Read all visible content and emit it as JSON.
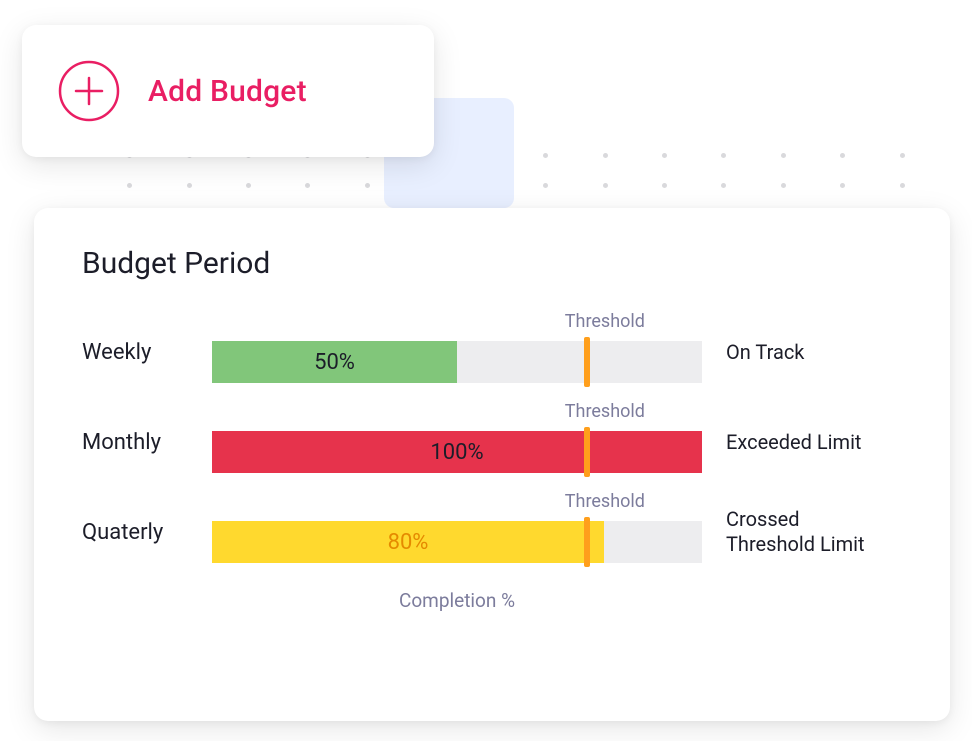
{
  "add_budget": {
    "label": "Add Budget"
  },
  "panel": {
    "title": "Budget Period",
    "threshold_label": "Threshold",
    "axis_label": "Completion %"
  },
  "rows": [
    {
      "label": "Weekly",
      "value_label": "50%",
      "status": "On Track"
    },
    {
      "label": "Monthly",
      "value_label": "100%",
      "status": "Exceeded Limit"
    },
    {
      "label": "Quaterly",
      "value_label": "80%",
      "status": "Crossed Threshold Limit"
    }
  ],
  "colors": {
    "accent_pink": "#e91e63",
    "green": "#81c67a",
    "red": "#e6334c",
    "yellow": "#ffd92e",
    "threshold_marker": "#ff9f1c",
    "track": "#ededef",
    "muted_text": "#7c7c9c",
    "text": "#1c1d29",
    "blue_tab": "#e8efff"
  },
  "chart_data": {
    "type": "bar",
    "orientation": "horizontal",
    "title": "Budget Period",
    "xlabel": "Completion %",
    "ylabel": "",
    "xlim": [
      0,
      100
    ],
    "threshold_percent": 76,
    "categories": [
      "Weekly",
      "Monthly",
      "Quaterly"
    ],
    "values": [
      50,
      100,
      80
    ],
    "series": [
      {
        "name": "Completion %",
        "values": [
          50,
          100,
          80
        ]
      }
    ],
    "annotations": [
      {
        "category": "Weekly",
        "status": "On Track",
        "color": "#81c67a"
      },
      {
        "category": "Monthly",
        "status": "Exceeded Limit",
        "color": "#e6334c"
      },
      {
        "category": "Quaterly",
        "status": "Crossed Threshold Limit",
        "color": "#ffd92e"
      }
    ]
  }
}
